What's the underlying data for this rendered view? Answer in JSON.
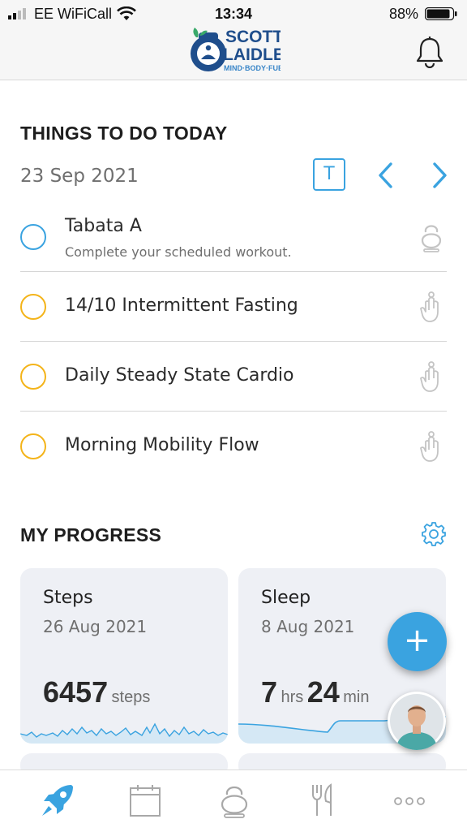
{
  "status_bar": {
    "carrier": "EE WiFiCall",
    "time": "13:34",
    "battery_percent": "88%"
  },
  "header": {
    "logo_line1": "SCOTT",
    "logo_line2": "LAIDLER",
    "logo_tagline": "MIND·BODY·FUEL",
    "bell_icon": "bell-icon"
  },
  "todo": {
    "section_title": "THINGS TO DO TODAY",
    "date": "23 Sep 2021",
    "today_button_label": "T",
    "tasks": [
      {
        "title": "Tabata A",
        "subtitle": "Complete your scheduled workout.",
        "circle_color": "#3aa3e0",
        "icon": "kettlebell-icon"
      },
      {
        "title": "14/10 Intermittent Fasting",
        "subtitle": "",
        "circle_color": "#f4b41a",
        "icon": "hand-finger-icon"
      },
      {
        "title": "Daily Steady State Cardio",
        "subtitle": "",
        "circle_color": "#f4b41a",
        "icon": "hand-finger-icon"
      },
      {
        "title": "Morning Mobility Flow",
        "subtitle": "",
        "circle_color": "#f4b41a",
        "icon": "hand-finger-icon"
      }
    ]
  },
  "progress": {
    "section_title": "MY PROGRESS",
    "cards": [
      {
        "title": "Steps",
        "date": "26 Aug 2021",
        "value": "6457",
        "unit": "steps"
      },
      {
        "title": "Sleep",
        "date": "8 Aug 2021",
        "hours": "7",
        "hours_unit": "hrs",
        "minutes": "24",
        "minutes_unit": "min"
      }
    ]
  },
  "fab": {
    "label": "+"
  },
  "tabbar": {
    "items": [
      "rocket-icon",
      "calendar-icon",
      "kettlebell-icon",
      "fork-knife-icon",
      "more-icon"
    ]
  },
  "colors": {
    "accent": "#3aa3e0",
    "pending": "#f4b41a",
    "card_bg": "#eef0f5"
  }
}
